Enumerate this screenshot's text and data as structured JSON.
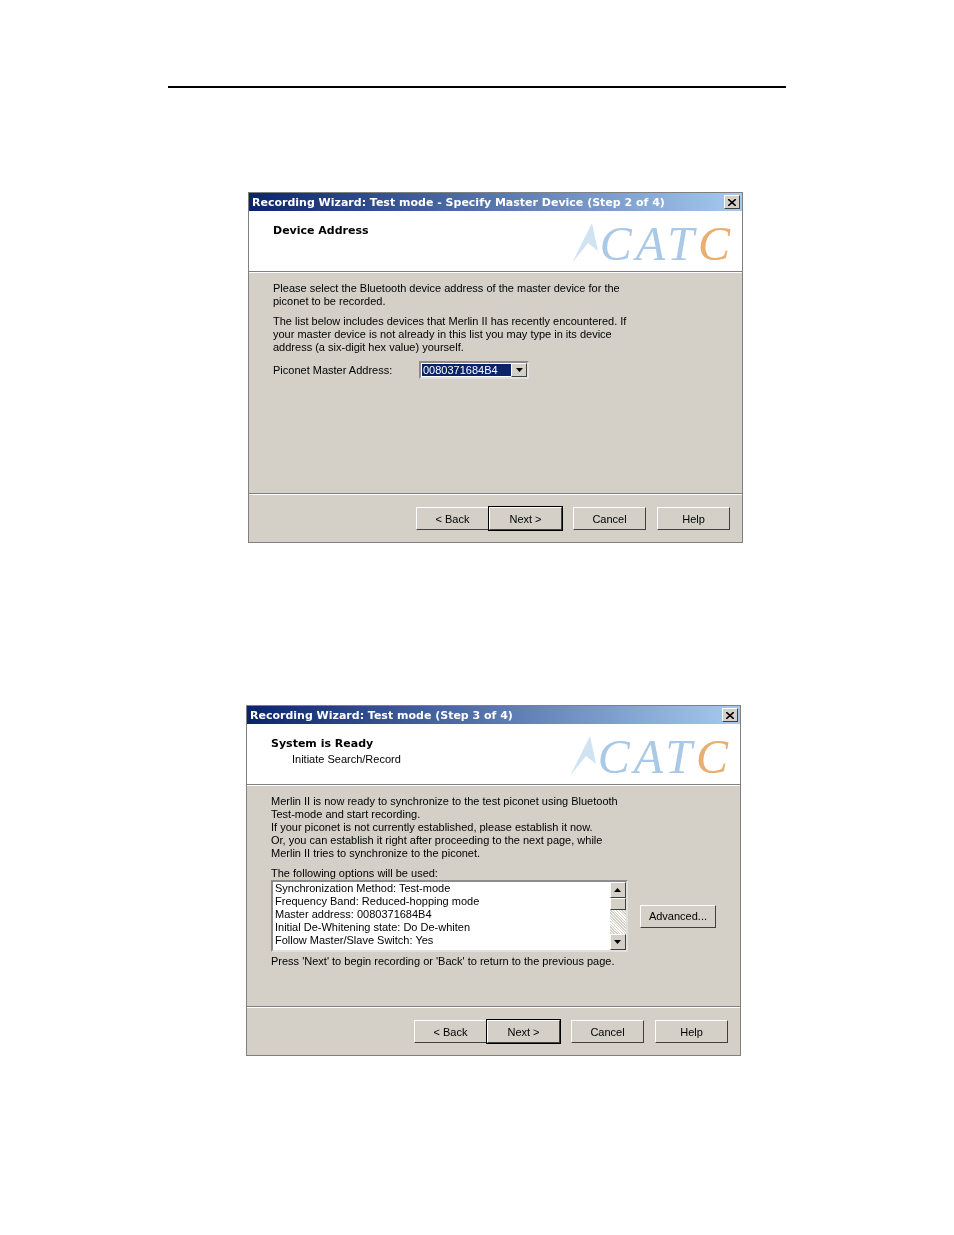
{
  "dialogs": [
    {
      "title": "Recording Wizard: Test mode - Specify Master Device (Step 2 of 4)",
      "heading": "Device Address",
      "logo": "CATC",
      "paragraphs": [
        "Please select the Bluetooth device address of the master device for the piconet to be recorded.",
        "The list below includes devices that Merlin II has recently encountered.  If your master device is not already in this list you may type in its device address (a six-digit hex value) yourself."
      ],
      "combo": {
        "label": "Piconet Master Address:",
        "value": "0080371684B4",
        "highlighted": true
      },
      "buttons": [
        {
          "label": "< Back",
          "default": false
        },
        {
          "label": "Next >",
          "default": true
        },
        {
          "label": "Cancel",
          "default": false
        },
        {
          "label": "Help",
          "default": false
        }
      ]
    },
    {
      "title": "Recording Wizard: Test mode (Step 3 of 4)",
      "heading": "System is Ready",
      "subheading": "Initiate Search/Record",
      "logo": "CATC",
      "paragraphs": [
        "Merlin II is now ready to synchronize to the test piconet using Bluetooth Test-mode and start recording.",
        "If your piconet is not currently established, please establish it now.",
        "Or, you can establish it right after proceeding to the next page, while Merlin II tries to synchronize to the piconet."
      ],
      "list": {
        "label": "The following options will be used:",
        "items": [
          "Synchronization Method: Test-mode",
          "Frequency Band: Reduced-hopping mode",
          "Master address: 0080371684B4",
          "Initial De-Whitening state: Do De-whiten",
          "Follow Master/Slave Switch: Yes"
        ],
        "side_button": "Advanced..."
      },
      "note": "Press 'Next' to begin recording or 'Back' to return to the previous page.",
      "buttons": [
        {
          "label": "< Back",
          "default": false
        },
        {
          "label": "Next >",
          "default": true
        },
        {
          "label": "Cancel",
          "default": false
        },
        {
          "label": "Help",
          "default": false
        }
      ]
    }
  ]
}
